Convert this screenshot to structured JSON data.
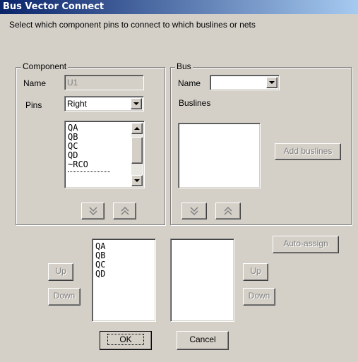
{
  "window": {
    "title": "Bus Vector Connect"
  },
  "instruction": "Select which component pins to connect to which buslines or nets",
  "component": {
    "legend": "Component",
    "name_label": "Name",
    "name_value": "U1",
    "pins_label": "Pins",
    "pins_value": "Right",
    "pin_list": [
      "QA",
      "QB",
      "QC",
      "QD",
      "~RCO"
    ]
  },
  "bus": {
    "legend": "Bus",
    "name_label": "Name",
    "name_value": "",
    "buslines_label": "Buslines",
    "add_buslines_button": "Add buslines"
  },
  "selected_pins": [
    "QA",
    "QB",
    "QC",
    "QD"
  ],
  "buttons": {
    "auto_assign": "Auto-assign",
    "up_left": "Up",
    "down_left": "Down",
    "up_right": "Up",
    "down_right": "Down",
    "ok": "OK",
    "cancel": "Cancel"
  },
  "colors": {
    "titlebar_start": "#0a246a",
    "titlebar_end": "#a6caf0",
    "face": "#d4d0c8"
  }
}
